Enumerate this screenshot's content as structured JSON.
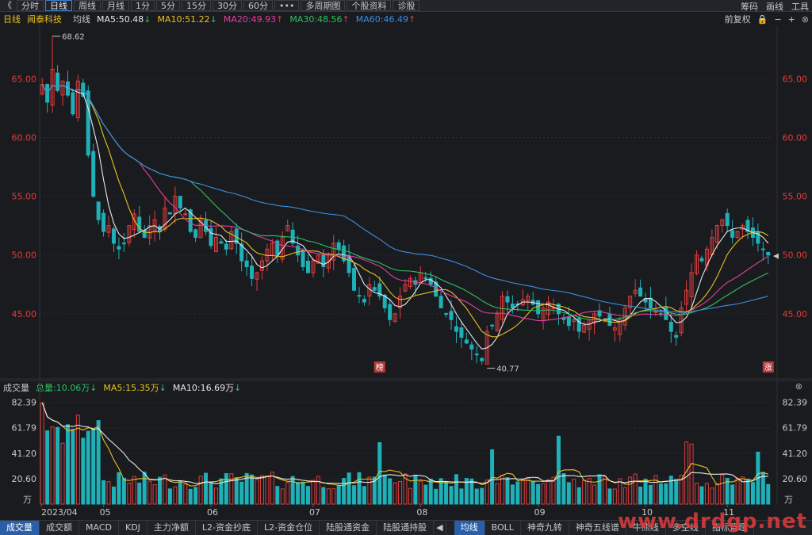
{
  "toolbar": {
    "back_glyph": "《",
    "buttons": [
      "分时",
      "日线",
      "周线",
      "月线",
      "1分",
      "5分",
      "15分",
      "30分",
      "60分",
      "•••",
      "多周期图",
      "个股资料",
      "诊股"
    ],
    "active": "日线",
    "right": [
      "筹码",
      "画线",
      "工具"
    ]
  },
  "mabar": {
    "period": "日线",
    "stock": "闻泰科技",
    "label": "均线",
    "ma": [
      {
        "text": "MA5:50.48",
        "dir": "↓",
        "color": "#e8e8e8"
      },
      {
        "text": "MA10:51.22",
        "dir": "↓",
        "color": "#e8c020"
      },
      {
        "text": "MA20:49.93",
        "dir": "↑",
        "color": "#e040a0"
      },
      {
        "text": "MA30:48.56",
        "dir": "↑",
        "color": "#30c060"
      },
      {
        "text": "MA60:46.49",
        "dir": "↑",
        "color": "#3a8ee0"
      }
    ],
    "right_label": "前复权"
  },
  "price_axis": {
    "ticks": [
      65.0,
      60.0,
      55.0,
      50.0,
      45.0
    ],
    "labels": [
      "65.00",
      "60.00",
      "55.00",
      "50.00",
      "45.00"
    ],
    "high_label": "68.62",
    "low_label": "40.77"
  },
  "markers": [
    {
      "text": "榜",
      "date_index": 66
    },
    {
      "text": "涨",
      "date_index": 142
    }
  ],
  "volume_bar": {
    "title": "成交量",
    "total": "总量:10.06万",
    "total_dir": "↓",
    "ma5": "MA5:15.35万",
    "ma5_dir": "↓",
    "ma10": "MA10:16.69万",
    "ma10_dir": "↓"
  },
  "volume_axis": {
    "labels": [
      "82.39",
      "61.79",
      "41.20",
      "20.60"
    ],
    "ticks": [
      82.39,
      61.79,
      41.2,
      20.6
    ],
    "unit": "万"
  },
  "x_axis": {
    "labels": [
      {
        "text": "2023/04",
        "index": 0
      },
      {
        "text": "05",
        "index": 12
      },
      {
        "text": "06",
        "index": 33
      },
      {
        "text": "07",
        "index": 53
      },
      {
        "text": "08",
        "index": 74
      },
      {
        "text": "09",
        "index": 97
      },
      {
        "text": "10",
        "index": 118
      },
      {
        "text": "11",
        "index": 134
      }
    ]
  },
  "bottom_tabs": {
    "left": [
      "成交量",
      "成交额",
      "MACD",
      "KDJ",
      "主力净额",
      "L2-资金抄底",
      "L2-资金仓位",
      "陆股通资金",
      "陆股通持股"
    ],
    "left_active": "成交量",
    "right": [
      "均线",
      "BOLL",
      "神奇九转",
      "神奇五线谱",
      "牛熊线",
      "多空线",
      "指标管理"
    ],
    "right_active": "均线"
  },
  "watermark": "www.drdgp.net",
  "chart_data": {
    "type": "candlestick",
    "title": "",
    "xlabel": "",
    "ylabel": "",
    "ylim": [
      40,
      69
    ],
    "volume_ylim": [
      0,
      86
    ],
    "up_color": "#e03c3c",
    "down_color": "#1fb0b8",
    "ohlc_close_approx": [
      64.5,
      63.0,
      65.8,
      64.0,
      64.8,
      63.6,
      62.0,
      64.8,
      63.5,
      58.5,
      55.0,
      53.0,
      52.0,
      52.5,
      51.0,
      50.5,
      51.0,
      52.5,
      53.5,
      52.0,
      51.5,
      52.5,
      53.0,
      52.0,
      54.0,
      53.5,
      55.0,
      54.0,
      53.5,
      52.0,
      51.5,
      53.0,
      52.0,
      50.8,
      51.5,
      51.0,
      50.5,
      52.0,
      51.0,
      49.5,
      49.0,
      48.0,
      48.5,
      49.5,
      50.5,
      51.0,
      50.0,
      51.5,
      52.5,
      51.0,
      50.0,
      49.0,
      48.5,
      49.5,
      50.0,
      49.0,
      50.0,
      51.0,
      50.5,
      49.5,
      48.5,
      47.0,
      46.5,
      46.0,
      47.5,
      47.0,
      46.5,
      45.5,
      44.5,
      45.0,
      46.5,
      47.5,
      48.0,
      47.5,
      48.5,
      48.0,
      47.5,
      46.5,
      45.5,
      45.0,
      44.5,
      43.5,
      43.0,
      42.5,
      42.0,
      41.5,
      41.0,
      43.5,
      44.0,
      45.0,
      46.5,
      46.0,
      45.5,
      45.8,
      46.2,
      46.5,
      45.8,
      45.0,
      45.5,
      46.0,
      45.5,
      45.0,
      44.5,
      44.0,
      44.5,
      43.5,
      44.0,
      44.5,
      45.0,
      44.8,
      44.5,
      44.0,
      43.8,
      44.5,
      45.5,
      46.5,
      47.0,
      46.5,
      46.0,
      45.5,
      45.2,
      45.0,
      44.5,
      43.5,
      43.0,
      45.5,
      47.0,
      48.5,
      50.0,
      49.5,
      50.5,
      51.5,
      52.5,
      53.0,
      52.5,
      51.5,
      52.0,
      52.5,
      52.0,
      51.5,
      51.0,
      50.5,
      50.0
    ],
    "ma_series_names": [
      "MA5",
      "MA10",
      "MA20",
      "MA30",
      "MA60"
    ],
    "volume_series_names": [
      "成交量",
      "MA5",
      "MA10"
    ],
    "high": 68.62,
    "low": 40.77
  }
}
